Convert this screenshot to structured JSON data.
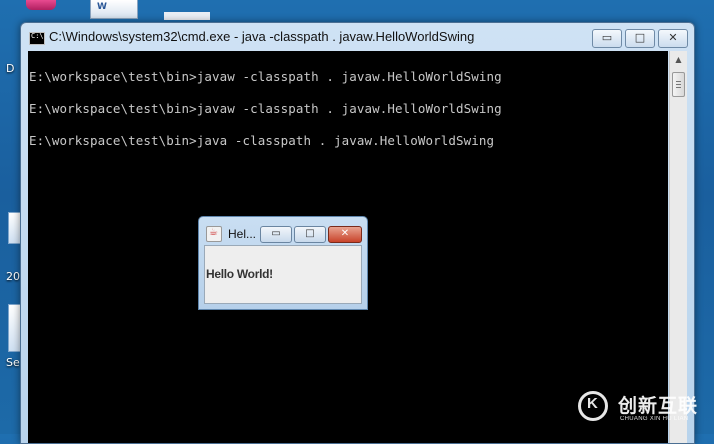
{
  "desktop": {
    "labels": [
      "D",
      "20",
      "Se"
    ],
    "word_icon_text": "W"
  },
  "console": {
    "title": "C:\\Windows\\system32\\cmd.exe - java  -classpath . javaw.HelloWorldSwing",
    "icon_text": "C:\\",
    "icon_name": "cmd-icon",
    "buttons": {
      "minimize_glyph": "▭",
      "maximize_glyph": "□",
      "close_glyph": "✕"
    },
    "lines": [
      "E:\\workspace\\test\\bin>javaw -classpath . javaw.HelloWorldSwing",
      "E:\\workspace\\test\\bin>javaw -classpath . javaw.HelloWorldSwing",
      "E:\\workspace\\test\\bin>java -classpath . javaw.HelloWorldSwing"
    ],
    "scroll_up_glyph": "▲"
  },
  "swing": {
    "title": "Hel...",
    "icon_name": "java-icon",
    "icon_text": "☕",
    "buttons": {
      "minimize_glyph": "▭",
      "maximize_glyph": "□",
      "close_glyph": "✕"
    },
    "content_text": "Hello World!"
  },
  "watermark": {
    "logo_text": "K",
    "cn": "创新互联",
    "en": "CHUANG XIN HU LIAN"
  },
  "colors": {
    "console_bg": "#000000",
    "console_text": "#c8c8c8",
    "desktop_blue": "#1d6aa8",
    "close_red": "#c8432a"
  }
}
